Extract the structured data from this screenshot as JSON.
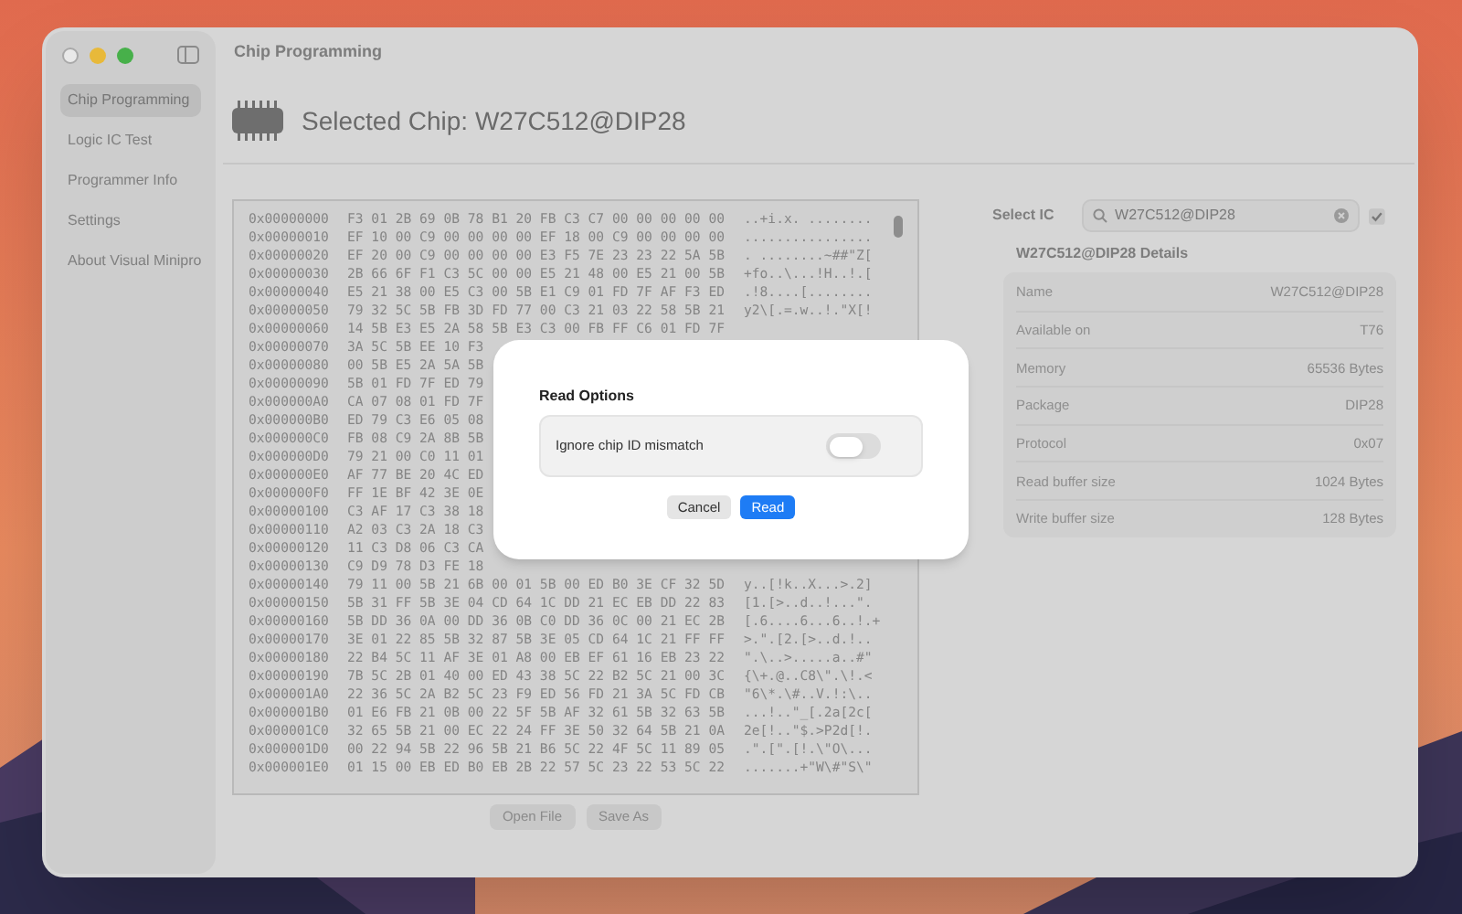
{
  "window": {
    "title": "Chip Programming"
  },
  "sidebar": {
    "items": [
      {
        "label": "Chip Programming",
        "selected": true
      },
      {
        "label": "Logic IC Test",
        "selected": false
      },
      {
        "label": "Programmer Info",
        "selected": false
      },
      {
        "label": "Settings",
        "selected": false
      },
      {
        "label": "About Visual Minipro",
        "selected": false
      }
    ]
  },
  "header": {
    "title": "Selected Chip: W27C512@DIP28"
  },
  "hex_view": {
    "rows": [
      {
        "address": "0x00000000",
        "bytes": "F3 01 2B 69 0B 78 B1 20 FB C3 C7 00 00 00 00 00",
        "ascii": "..+i.x. ........"
      },
      {
        "address": "0x00000010",
        "bytes": "EF 10 00 C9 00 00 00 00 EF 18 00 C9 00 00 00 00",
        "ascii": "................"
      },
      {
        "address": "0x00000020",
        "bytes": "EF 20 00 C9 00 00 00 00 E3 F5 7E 23 23 22 5A 5B",
        "ascii": ". ........~##\"Z["
      },
      {
        "address": "0x00000030",
        "bytes": "2B 66 6F F1 C3 5C 00 00 E5 21 48 00 E5 21 00 5B",
        "ascii": "+fo..\\...!H..!.["
      },
      {
        "address": "0x00000040",
        "bytes": "E5 21 38 00 E5 C3 00 5B E1 C9 01 FD 7F AF F3 ED",
        "ascii": ".!8....[........"
      },
      {
        "address": "0x00000050",
        "bytes": "79 32 5C 5B FB 3D FD 77 00 C3 21 03 22 58 5B 21",
        "ascii": "y2\\[.=.w..!.\"X[!"
      },
      {
        "address": "0x00000060",
        "bytes": "14 5B E3 E5 2A 58 5B E3 C3 00 FB FF C6 01 FD 7F"
      },
      {
        "address": "0x00000070",
        "bytes": "3A 5C 5B EE 10 F3"
      },
      {
        "address": "0x00000080",
        "bytes": "00 5B E5 2A 5A 5B"
      },
      {
        "address": "0x00000090",
        "bytes": "5B 01 FD 7F ED 79"
      },
      {
        "address": "0x000000A0",
        "bytes": "CA 07 08 01 FD 7F"
      },
      {
        "address": "0x000000B0",
        "bytes": "ED 79 C3 E6 05 08"
      },
      {
        "address": "0x000000C0",
        "bytes": "FB 08 C9 2A 8B 5B"
      },
      {
        "address": "0x000000D0",
        "bytes": "79 21 00 C0 11 01"
      },
      {
        "address": "0x000000E0",
        "bytes": "AF 77 BE 20 4C ED"
      },
      {
        "address": "0x000000F0",
        "bytes": "FF 1E BF 42 3E 0E"
      },
      {
        "address": "0x00000100",
        "bytes": "C3 AF 17 C3 38 18"
      },
      {
        "address": "0x00000110",
        "bytes": "A2 03 C3 2A 18 C3"
      },
      {
        "address": "0x00000120",
        "bytes": "11 C3 D8 06 C3 CA"
      },
      {
        "address": "0x00000130",
        "bytes": "C9 D9 78 D3 FE 18"
      },
      {
        "address": "0x00000140",
        "bytes": "79 11 00 5B 21 6B 00 01 5B 00 ED B0 3E CF 32 5D",
        "ascii": "y..[!k..X...>.2]"
      },
      {
        "address": "0x00000150",
        "bytes": "5B 31 FF 5B 3E 04 CD 64 1C DD 21 EC EB DD 22 83",
        "ascii": "[1.[>..d..!...\"."
      },
      {
        "address": "0x00000160",
        "bytes": "5B DD 36 0A 00 DD 36 0B C0 DD 36 0C 00 21 EC 2B",
        "ascii": "[.6....6...6..!.+"
      },
      {
        "address": "0x00000170",
        "bytes": "3E 01 22 85 5B 32 87 5B 3E 05 CD 64 1C 21 FF FF",
        "ascii": ">.\".[2.[>..d.!.."
      },
      {
        "address": "0x00000180",
        "bytes": "22 B4 5C 11 AF 3E 01 A8 00 EB EF 61 16 EB 23 22",
        "ascii": "\".\\..>.....a..#\""
      },
      {
        "address": "0x00000190",
        "bytes": "7B 5C 2B 01 40 00 ED 43 38 5C 22 B2 5C 21 00 3C",
        "ascii": "{\\+.@..C8\\\".\\!.<"
      },
      {
        "address": "0x000001A0",
        "bytes": "22 36 5C 2A B2 5C 23 F9 ED 56 FD 21 3A 5C FD CB",
        "ascii": "\"6\\*.\\#..V.!:\\.."
      },
      {
        "address": "0x000001B0",
        "bytes": "01 E6 FB 21 0B 00 22 5F 5B AF 32 61 5B 32 63 5B",
        "ascii": "...!..\"_[.2a[2c["
      },
      {
        "address": "0x000001C0",
        "bytes": "32 65 5B 21 00 EC 22 24 FF 3E 50 32 64 5B 21 0A",
        "ascii": "2e[!..\"$.>P2d[!."
      },
      {
        "address": "0x000001D0",
        "bytes": "00 22 94 5B 22 96 5B 21 B6 5C 22 4F 5C 11 89 05",
        "ascii": ".\".[\".[!.\\\"O\\..."
      },
      {
        "address": "0x000001E0",
        "bytes": "01 15 00 EB ED B0 EB 2B 22 57 5C 23 22 53 5C 22",
        "ascii": ".......+\"W\\#\"S\\\""
      }
    ]
  },
  "file_buttons": [
    "Open File",
    "Save As"
  ],
  "select_ic": {
    "label": "Select IC",
    "search_value": "W27C512@DIP28"
  },
  "details": {
    "title": "W27C512@DIP28 Details",
    "rows": [
      {
        "label": "Name",
        "value": "W27C512@DIP28"
      },
      {
        "label": "Available on",
        "value": "T76"
      },
      {
        "label": "Memory",
        "value": "65536 Bytes"
      },
      {
        "label": "Package",
        "value": "DIP28"
      },
      {
        "label": "Protocol",
        "value": "0x07"
      },
      {
        "label": "Read buffer size",
        "value": "1024 Bytes"
      },
      {
        "label": "Write buffer size",
        "value": "128 Bytes"
      }
    ]
  },
  "dialog": {
    "title": "Read Options",
    "options": [
      {
        "label": "Ignore chip ID mismatch",
        "on": false
      }
    ],
    "buttons": [
      {
        "label": "Cancel",
        "kind": "secondary"
      },
      {
        "label": "Read",
        "kind": "primary"
      }
    ]
  }
}
